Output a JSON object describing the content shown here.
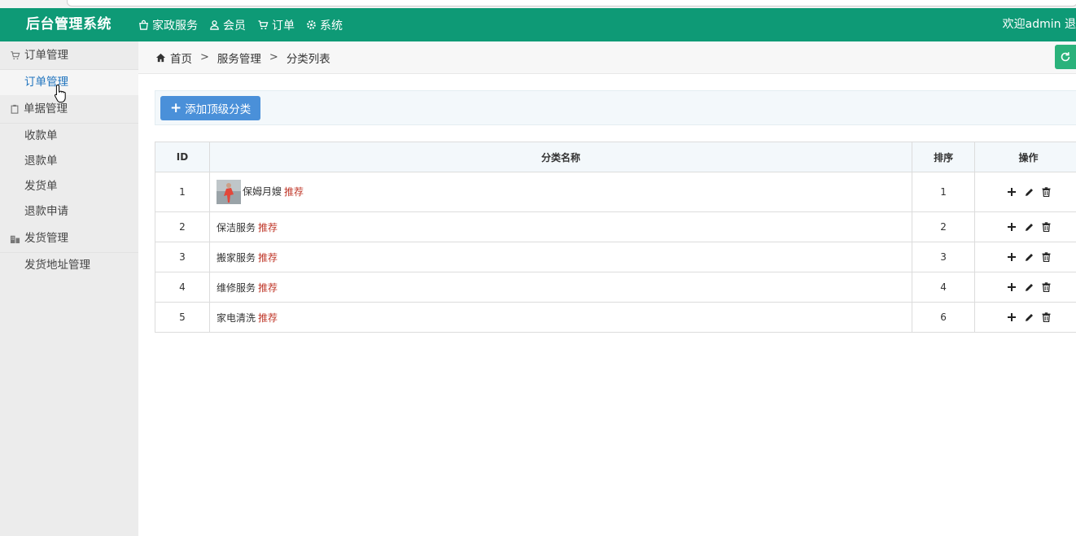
{
  "header": {
    "brand": "后台管理系统",
    "nav": [
      {
        "label": "家政服务",
        "icon": "shopping-bag-icon"
      },
      {
        "label": "会员",
        "icon": "user-icon"
      },
      {
        "label": "订单",
        "icon": "cart-icon"
      },
      {
        "label": "系统",
        "icon": "gear-icon"
      }
    ],
    "welcome": "欢迎admin 退"
  },
  "sidebar": {
    "groups": [
      {
        "label": "订单管理",
        "icon": "cart-icon",
        "items": [
          "订单管理"
        ]
      },
      {
        "label": "单据管理",
        "icon": "clipboard-icon",
        "items": [
          "收款单",
          "退款单",
          "发货单",
          "退款申请"
        ]
      },
      {
        "label": "发货管理",
        "icon": "building-icon",
        "items": [
          "发货地址管理"
        ]
      }
    ],
    "active_item": "订单管理"
  },
  "breadcrumb": [
    "首页",
    "服务管理",
    "分类列表"
  ],
  "breadcrumb_sep": ">",
  "toolbar": {
    "add_label": "添加顶级分类"
  },
  "table": {
    "columns": [
      "ID",
      "分类名称",
      "排序",
      "操作"
    ],
    "rows": [
      {
        "id": "1",
        "name": "保姆月嫂",
        "tag": "推荐",
        "sort": "1",
        "has_thumb": true
      },
      {
        "id": "2",
        "name": "保洁服务",
        "tag": "推荐",
        "sort": "2",
        "has_thumb": false
      },
      {
        "id": "3",
        "name": "搬家服务",
        "tag": "推荐",
        "sort": "3",
        "has_thumb": false
      },
      {
        "id": "4",
        "name": "维修服务",
        "tag": "推荐",
        "sort": "4",
        "has_thumb": false
      },
      {
        "id": "5",
        "name": "家电清洗",
        "tag": "推荐",
        "sort": "6",
        "has_thumb": false
      }
    ],
    "ops_icons": [
      "plus-icon",
      "pencil-icon",
      "trash-icon"
    ]
  },
  "colors": {
    "header_bg": "#0e9a76",
    "tag": "#c0392b",
    "button": "#4a90d9",
    "active_link": "#1e73be"
  }
}
